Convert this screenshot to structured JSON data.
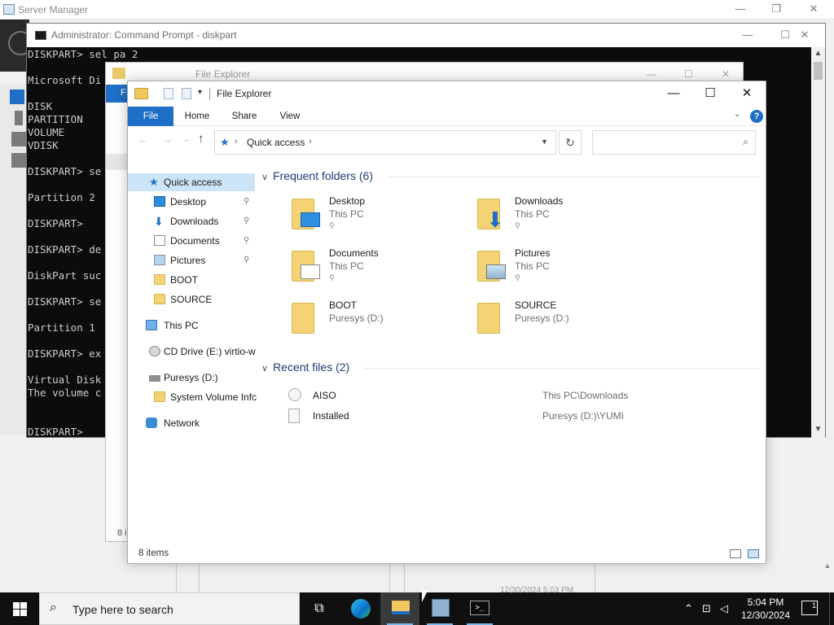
{
  "server_manager": {
    "title": "Server Manager",
    "timestamp": "12/30/2024 5:03 PM"
  },
  "cmd": {
    "title": "Administrator: Command Prompt - diskpart",
    "lines": [
      "DISKPART> sel pa 2",
      "",
      "Microsoft Di",
      "",
      "DISK",
      "PARTITION",
      "VOLUME",
      "VDISK",
      "",
      "DISKPART> se",
      "",
      "Partition 2",
      "",
      "DISKPART>",
      "",
      "DISKPART> de",
      "",
      "DiskPart suc",
      "",
      "DISKPART> se",
      "",
      "Partition 1",
      "",
      "DISKPART> ex",
      "",
      "Virtual Disk",
      "The volume c",
      "",
      "",
      "DISKPART>"
    ]
  },
  "ghost_explorer": {
    "title": "File Explorer",
    "file_tab": "F",
    "item_count": "8 i"
  },
  "explorer": {
    "title": "File Explorer",
    "controls": {
      "minimize": "—",
      "maximize": "☐",
      "close": "✕"
    },
    "tabs": [
      "File",
      "Home",
      "Share",
      "View"
    ],
    "help": "?",
    "address": {
      "location": "Quick access",
      "sep": "›",
      "search_placeholder": ""
    },
    "nav": {
      "back": "←",
      "forward": "→",
      "recent": "⌄",
      "up": "↑",
      "refresh": "↻"
    },
    "nav_pane": [
      {
        "label": "Quick access",
        "icon": "star-icon"
      },
      {
        "label": "Desktop",
        "icon": "desktop-icon",
        "pinned": true
      },
      {
        "label": "Downloads",
        "icon": "download-icon",
        "pinned": true
      },
      {
        "label": "Documents",
        "icon": "documents-icon",
        "pinned": true
      },
      {
        "label": "Pictures",
        "icon": "pictures-icon",
        "pinned": true
      },
      {
        "label": "BOOT",
        "icon": "folder-icon"
      },
      {
        "label": "SOURCE",
        "icon": "folder-icon"
      },
      {
        "label": "This PC",
        "icon": "computer-icon"
      },
      {
        "label": "CD Drive (E:) virtio-w",
        "icon": "cd-drive-icon"
      },
      {
        "label": "Puresys (D:)",
        "icon": "drive-icon"
      },
      {
        "label": "System Volume Infc",
        "icon": "folder-icon"
      },
      {
        "label": "Network",
        "icon": "network-icon"
      }
    ],
    "frequent": {
      "heading": "Frequent folders (6)",
      "items": [
        {
          "name": "Desktop",
          "location": "This PC",
          "pinned": true,
          "overlay": "desktop"
        },
        {
          "name": "Downloads",
          "location": "This PC",
          "pinned": true,
          "overlay": "download"
        },
        {
          "name": "Documents",
          "location": "This PC",
          "pinned": true,
          "overlay": "document"
        },
        {
          "name": "Pictures",
          "location": "This PC",
          "pinned": true,
          "overlay": "picture"
        },
        {
          "name": "BOOT",
          "location": "Puresys (D:)",
          "pinned": false,
          "overlay": "none"
        },
        {
          "name": "SOURCE",
          "location": "Puresys (D:)",
          "pinned": false,
          "overlay": "none"
        }
      ]
    },
    "recent": {
      "heading": "Recent files (2)",
      "items": [
        {
          "name": "AISO",
          "path": "This PC\\Downloads"
        },
        {
          "name": "Installed",
          "path": "Puresys (D:)\\YUMI"
        }
      ]
    },
    "status": {
      "count": "8 items"
    }
  },
  "taskbar": {
    "search_placeholder": "Type here to search",
    "apps": [
      "task-view",
      "edge",
      "file-explorer",
      "server-manager",
      "command-prompt"
    ],
    "clock_time": "5:04 PM",
    "clock_date": "12/30/2024",
    "notification_count": "1"
  },
  "colors": {
    "accent": "#1e6fc5",
    "selection": "#cce4f7",
    "taskbar": "#101010",
    "console_bg": "#0c0c0c"
  }
}
